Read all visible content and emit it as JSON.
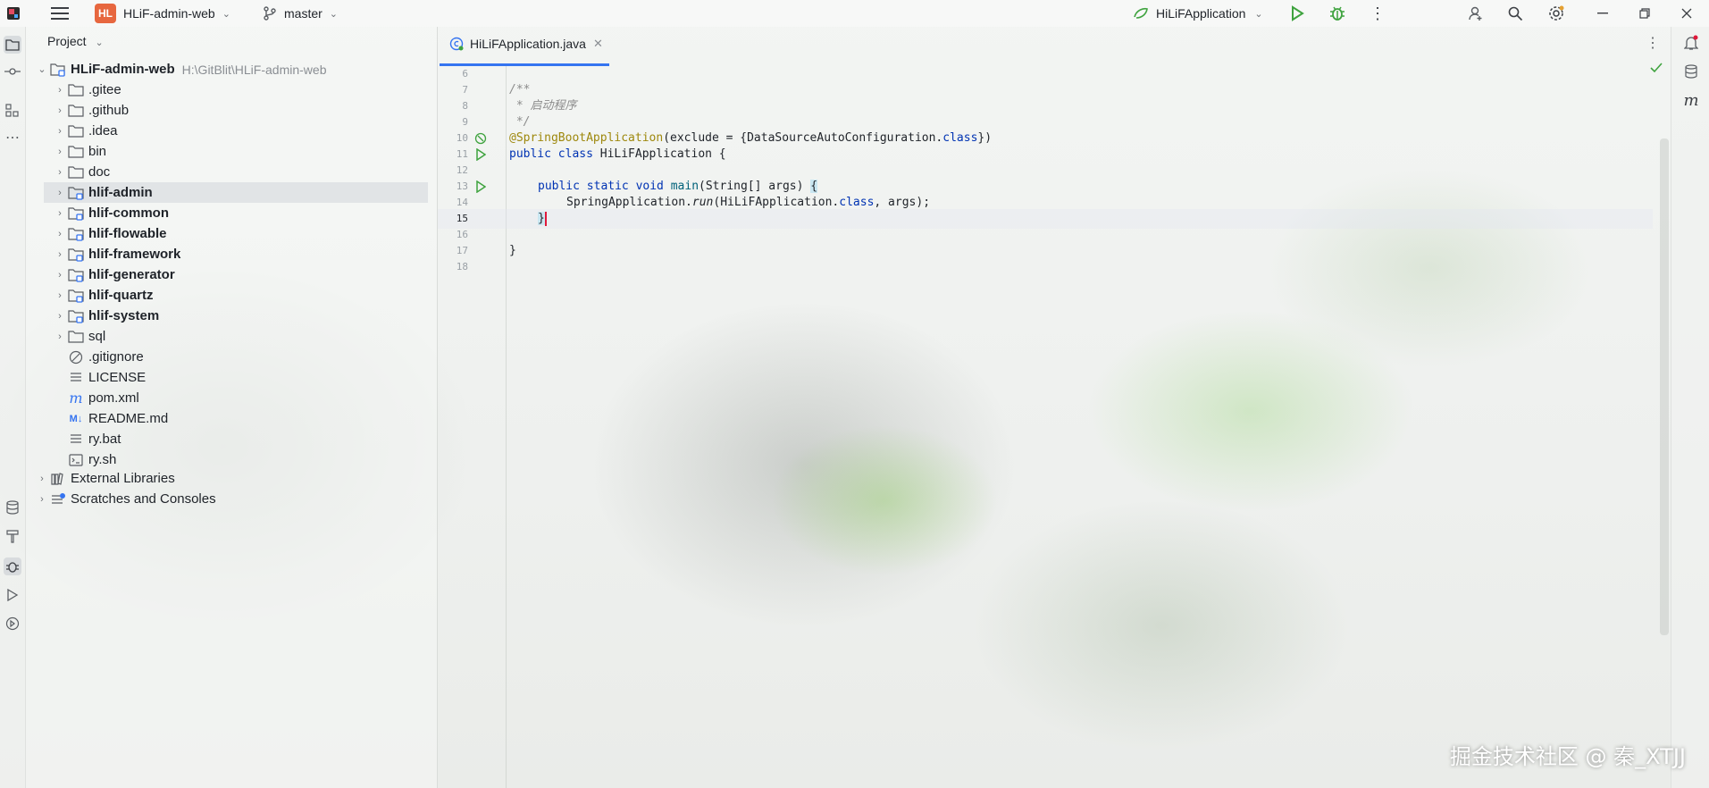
{
  "topbar": {
    "project_badge": "HL",
    "project_name": "HLiF-admin-web",
    "branch": "master",
    "run_config": "HiLiFApplication"
  },
  "project_panel": {
    "title": "Project",
    "root": {
      "name": "HLiF-admin-web",
      "path": "H:\\GitBlit\\HLiF-admin-web"
    },
    "items": [
      {
        "label": ".gitee",
        "kind": "folder"
      },
      {
        "label": ".github",
        "kind": "folder"
      },
      {
        "label": ".idea",
        "kind": "folder"
      },
      {
        "label": "bin",
        "kind": "folder"
      },
      {
        "label": "doc",
        "kind": "folder"
      },
      {
        "label": "hlif-admin",
        "kind": "module"
      },
      {
        "label": "hlif-common",
        "kind": "module"
      },
      {
        "label": "hlif-flowable",
        "kind": "module"
      },
      {
        "label": "hlif-framework",
        "kind": "module"
      },
      {
        "label": "hlif-generator",
        "kind": "module"
      },
      {
        "label": "hlif-quartz",
        "kind": "module"
      },
      {
        "label": "hlif-system",
        "kind": "module"
      },
      {
        "label": "sql",
        "kind": "folder"
      },
      {
        "label": ".gitignore",
        "kind": "ignore"
      },
      {
        "label": "LICENSE",
        "kind": "text"
      },
      {
        "label": "pom.xml",
        "kind": "maven"
      },
      {
        "label": "README.md",
        "kind": "markdown"
      },
      {
        "label": "ry.bat",
        "kind": "text"
      },
      {
        "label": "ry.sh",
        "kind": "shell"
      }
    ],
    "external_libraries": "External Libraries",
    "scratches": "Scratches and Consoles"
  },
  "editor": {
    "tab": "HiLiFApplication.java",
    "line_numbers": [
      "6",
      "7",
      "8",
      "9",
      "10",
      "11",
      "12",
      "13",
      "14",
      "15",
      "16",
      "17",
      "18"
    ],
    "lines": {
      "l7": "/**",
      "l8": " * 启动程序",
      "l9": " */",
      "l10_ann": "@SpringBootApplication",
      "l10_a": "(exclude = {DataSourceAutoConfiguration.",
      "l10_kw": "class",
      "l10_b": "})",
      "l11_kw": "public class",
      "l11_rest": " HiLiFApplication {",
      "l13_kw": "public static void",
      "l13_fn": "main",
      "l13_rest": "(String[] args) ",
      "l13_brace": "{",
      "l14_a": "SpringApplication.",
      "l14_run": "run",
      "l14_b": "(HiLiFApplication.",
      "l14_kw": "class",
      "l14_c": ", args);",
      "l15": "}",
      "l17": "}"
    }
  },
  "watermark": "掘金技术社区 @ 秦_XTJJ",
  "colors": {
    "accent": "#3574f0",
    "badge": "#e7673f",
    "run": "#3fa33f"
  }
}
